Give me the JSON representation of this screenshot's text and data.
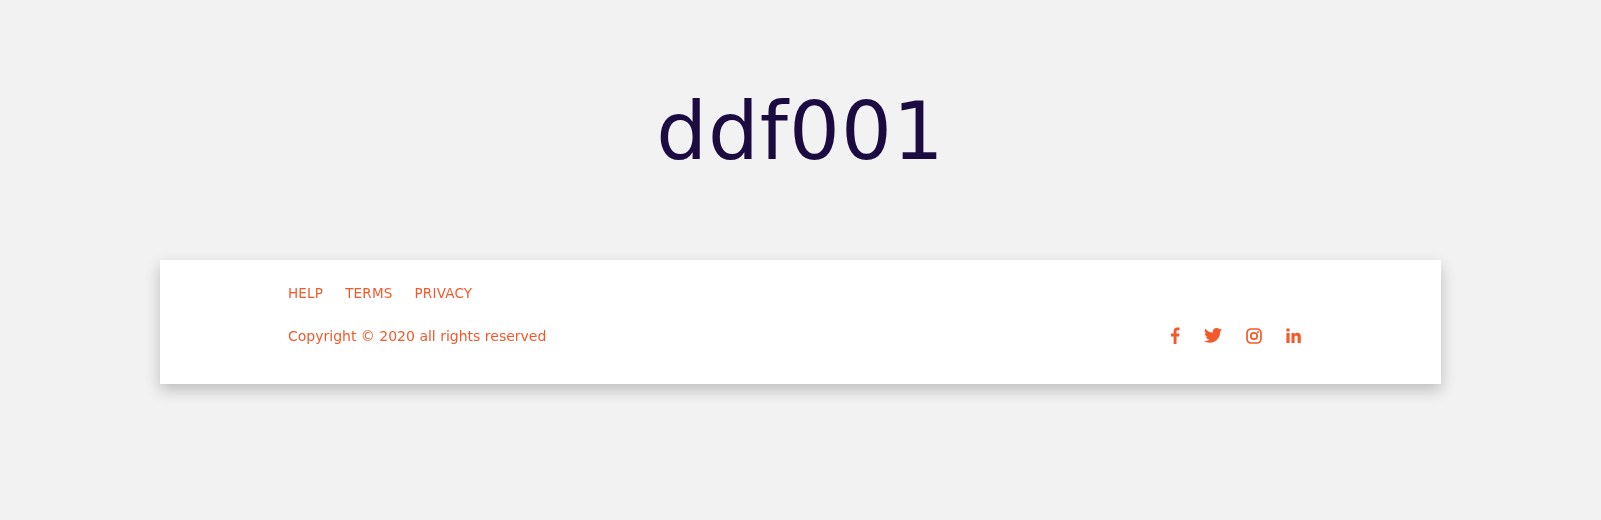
{
  "title": "ddf001",
  "footer": {
    "links": [
      "HELP",
      "TERMS",
      "PRIVACY"
    ],
    "copyright": "Copyright © 2020 all rights reserved",
    "social": [
      {
        "kind": "facebook"
      },
      {
        "kind": "twitter"
      },
      {
        "kind": "instagram"
      },
      {
        "kind": "linkedin"
      }
    ]
  }
}
